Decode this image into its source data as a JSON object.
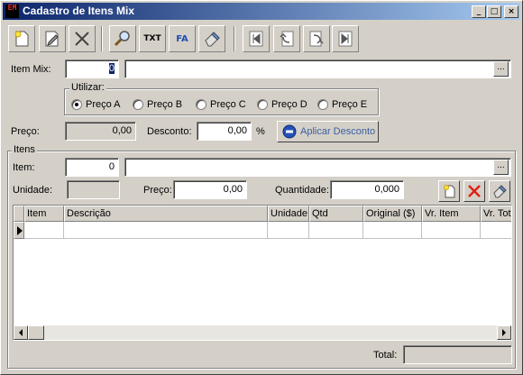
{
  "window": {
    "title": "Cadastro de Itens Mix",
    "app_icon_text": "EM",
    "controls": {
      "minimize": "_",
      "maximize": "□",
      "close": "×"
    }
  },
  "toolbar": {
    "new": "new-document-icon",
    "edit": "edit-icon",
    "delete": "delete-x-icon",
    "search": "magnifier-icon",
    "export_txt": "TXT",
    "export_fa": "FA",
    "clear": "eraser-icon",
    "first": "first-record-icon",
    "prev": "previous-record-icon",
    "next": "next-record-icon",
    "last": "last-record-icon"
  },
  "form": {
    "item_mix_label": "Item Mix:",
    "item_mix_code": "0",
    "item_mix_desc": "",
    "utilizar_title": "Utilizar:",
    "price_options": [
      {
        "label": "Preço A",
        "selected": true
      },
      {
        "label": "Preço B",
        "selected": false
      },
      {
        "label": "Preço C",
        "selected": false
      },
      {
        "label": "Preço D",
        "selected": false
      },
      {
        "label": "Preço E",
        "selected": false
      }
    ],
    "preco_label": "Preço:",
    "preco_value": "0,00",
    "desconto_label": "Desconto:",
    "desconto_value": "0,00",
    "percent": "%",
    "apply_button": "Aplicar Desconto",
    "ellipsis": "..."
  },
  "itens": {
    "title": "Itens",
    "item_label": "Item:",
    "item_code": "0",
    "item_desc": "",
    "unidade_label": "Unidade:",
    "unidade_value": "",
    "preco_label": "Preço:",
    "preco_value": "0,00",
    "quantidade_label": "Quantidade:",
    "quantidade_value": "0,000",
    "columns": [
      "Item",
      "Descrição",
      "Unidade",
      "Qtd",
      "Original ($)",
      "Vr. Item",
      "Vr. Tot"
    ],
    "total_label": "Total:",
    "total_value": ""
  },
  "colors": {
    "face": "#d4d0c8",
    "title_start": "#0a246a",
    "title_end": "#a6caf0",
    "link_blue": "#3a5fa0"
  }
}
